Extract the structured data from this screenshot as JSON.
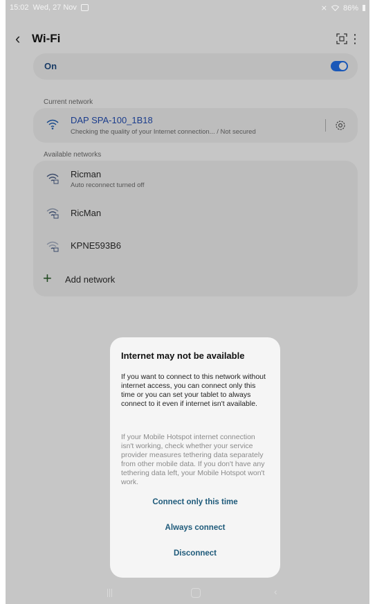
{
  "status_bar": {
    "time": "15:02",
    "date": "Wed, 27 Nov",
    "battery": "86%",
    "icons": [
      "image-icon",
      "mute-icon",
      "wifi-icon",
      "battery-icon"
    ]
  },
  "header": {
    "title": "Wi-Fi",
    "icons": [
      "back-icon",
      "qr-scan-icon",
      "more-options-icon"
    ]
  },
  "wifi_toggle": {
    "label": "On",
    "enabled": true,
    "accent": "#1a58b8"
  },
  "current_network": {
    "section_label": "Current network",
    "name": "DAP SPA-100_1B18",
    "status": "Checking the quality of your Internet connection... / Not secured",
    "name_color": "#1a3c8c"
  },
  "available_networks": {
    "section_label": "Available networks",
    "items": [
      {
        "name": "Ricman",
        "subtitle": "Auto reconnect turned off",
        "icon": "wifi-lock-icon"
      },
      {
        "name": "RicMan",
        "subtitle": "",
        "icon": "wifi-lock-icon"
      },
      {
        "name": "KPNE593B6",
        "subtitle": "",
        "icon": "wifi-lock-icon"
      }
    ],
    "add_label": "Add network"
  },
  "dialog": {
    "title": "Internet may not be available",
    "body": "If you want to connect to this network without internet access, you can connect only this time or you can set your tablet to always connect to it even if internet isn't available.",
    "note": "If your Mobile Hotspot internet connection isn't working, check whether your service provider measures tethering data separately from other mobile data. If you don't have any tethering data left, your Mobile Hotspot won't work.",
    "buttons": {
      "connect_once": "Connect only this time",
      "always_connect": "Always connect",
      "disconnect": "Disconnect"
    },
    "button_color": "#1e5a7a"
  },
  "nav_bar": {
    "icons": [
      "recent-apps-icon",
      "home-icon",
      "back-nav-icon"
    ]
  }
}
